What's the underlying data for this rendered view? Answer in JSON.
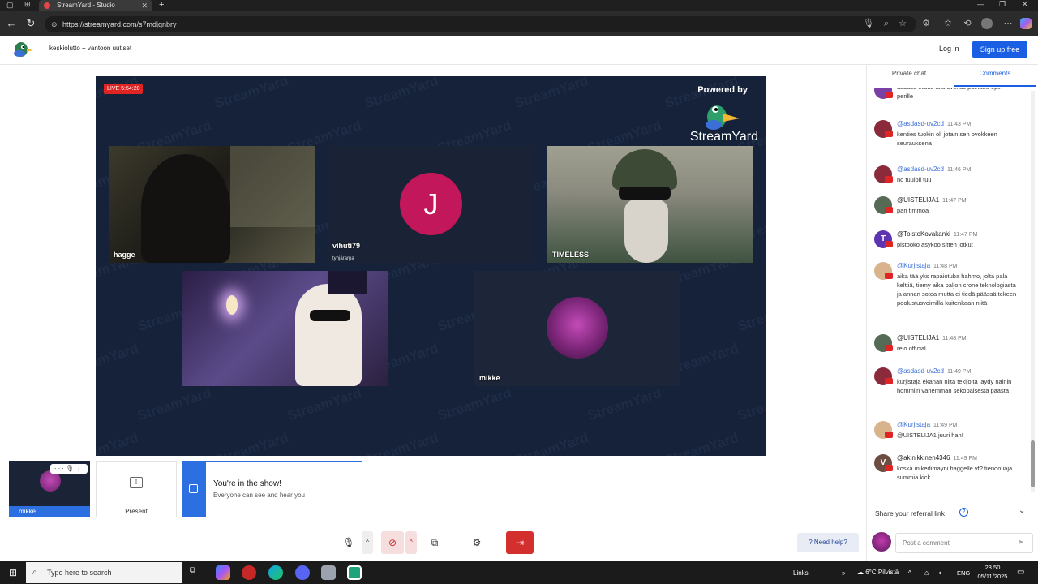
{
  "browser": {
    "tab_title": "StreamYard - Studio",
    "url": "https://streamyard.com/s7mdjqnbry"
  },
  "header": {
    "show_title": "keskiolutto + vantoon uutiset",
    "login_label": "Log in",
    "signup_label": "Sign up free"
  },
  "stage": {
    "live_badge": "LIVE 5:54:20",
    "powered_by": "Powered by",
    "brand": "StreamYard",
    "watermark": "StreamYard",
    "participants": [
      {
        "name": "hagge"
      },
      {
        "name": "vihuti79",
        "subtitle": "tyhjärarpa",
        "initial": "J",
        "avatar_color": "#c2185b"
      },
      {
        "name": "TIMELESS"
      },
      {
        "name": ""
      },
      {
        "name": "mikke"
      }
    ]
  },
  "tray": {
    "self_name": "mikke",
    "present_label": "Present",
    "notice_title": "You're in the show!",
    "notice_subtitle": "Everyone can see and hear you"
  },
  "toolbar": {
    "help_label": "Need help?",
    "icons": [
      "mic-icon",
      "camera-off-icon",
      "screen-share-icon",
      "settings-icon",
      "leave-icon"
    ]
  },
  "sidepanel": {
    "tab_private": "Private chat",
    "tab_comments": "Comments",
    "referral_label": "Share your referral link",
    "comment_placeholder": "Post a comment",
    "comments": [
      {
        "user": "",
        "time": "",
        "text": "asdasd olisko alla ovokas painanu opin perille",
        "avatar": "#7b3fa8",
        "initial": "",
        "partial": true
      },
      {
        "user": "@asdasd-uv2cd",
        "time": "11:43 PM",
        "text": "kenties tuokin oli jotain sen ovokkeen seurauksena",
        "avatar": "#8b2a3a",
        "initial": ""
      },
      {
        "user": "@asdasd-uv2cd",
        "time": "11:46 PM",
        "text": "no tuuloli tuu",
        "avatar": "#8b2a3a",
        "initial": ""
      },
      {
        "user": "@UISTELIJA1",
        "time": "11:47 PM",
        "text": "pari timmoa",
        "avatar": "#556b55",
        "initial": "",
        "dark": true
      },
      {
        "user": "@ToistoKovakanki",
        "time": "11:47 PM",
        "text": "pistöökö asykoo sitten jotkut",
        "avatar": "#5e35b1",
        "initial": "T",
        "dark": true
      },
      {
        "user": "@Kurjistaja",
        "time": "11:48 PM",
        "text": "aika tää yks rapaiotuba hahmo, jolta pala kelttiä, tiemy aika paljon crone teknologiasta ja annan sotea mutta ei tiedä päässä tekeen poolustusvoimilla kuitenkaan niitä",
        "avatar": "#d9b38c",
        "initial": ""
      },
      {
        "user": "@UISTELIJA1",
        "time": "11:48 PM",
        "text": "relo official",
        "avatar": "#556b55",
        "initial": "",
        "dark": true
      },
      {
        "user": "@asdasd-uv2cd",
        "time": "11:49 PM",
        "text": "kurjistaja ekänan niitä tekijöitä läydy nainin hommiin vähemmän sekopäisestä päästä",
        "avatar": "#8b2a3a",
        "initial": ""
      },
      {
        "user": "@Kurjistaja",
        "time": "11:49 PM",
        "text": "@UISTELIJA1 juuri han!",
        "avatar": "#d9b38c",
        "initial": ""
      },
      {
        "user": "@akinikkinen4346",
        "time": "11:49 PM",
        "text": "koska mikedimayni haggelle vf? tienoo iaja summia kick",
        "avatar": "#6d4c41",
        "initial": "V",
        "dark": true
      }
    ]
  },
  "taskbar": {
    "search_placeholder": "Type here to search",
    "links_label": "Links",
    "weather": "6°C Pilvistä",
    "language": "ENG",
    "time": "23.50",
    "date": "05/11/2025"
  }
}
